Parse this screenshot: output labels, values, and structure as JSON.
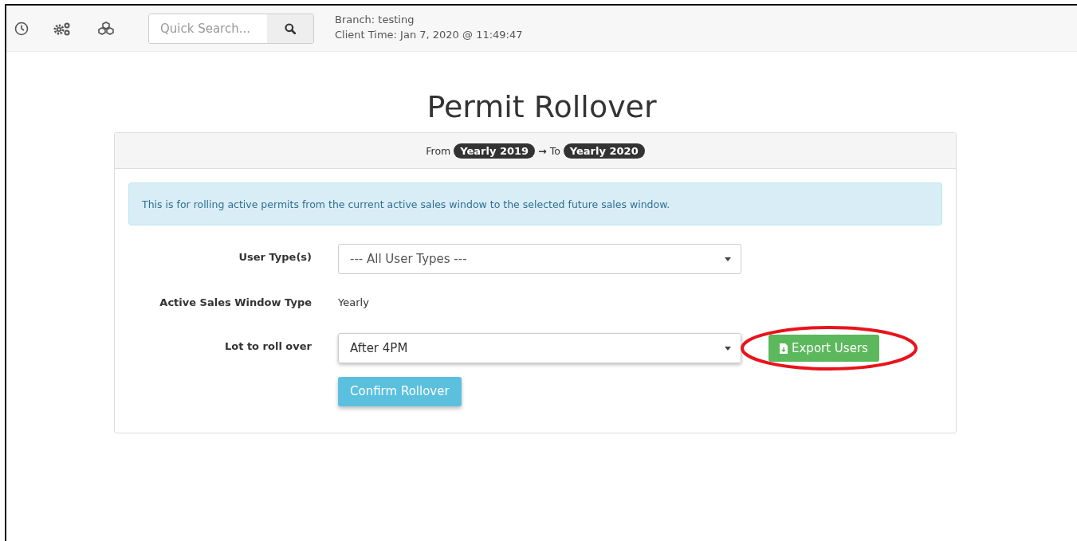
{
  "toolbar": {
    "icons": [
      {
        "kind": "clock"
      },
      {
        "kind": "gears"
      },
      {
        "kind": "cubes"
      }
    ],
    "search": {
      "placeholder": "Quick Search..."
    },
    "branch": "Branch: testing",
    "client_time": "Client Time: Jan 7, 2020 @ 11:49:47"
  },
  "page": {
    "title": "Permit Rollover"
  },
  "panel": {
    "from_label": "From",
    "from_badge": "Yearly 2019",
    "arrow": "→",
    "to_label": "To",
    "to_badge": "Yearly 2020",
    "alert": "This is for rolling active permits from the current active sales window to the selected future sales window.",
    "fields": [
      {
        "kind": "select",
        "label": "User Type(s)",
        "value": "--- All User Types ---"
      },
      {
        "kind": "text",
        "label": "Active Sales Window Type",
        "value": "Yearly"
      },
      {
        "kind": "select",
        "label": "Lot to roll over",
        "value": "After 4PM",
        "export_button": "Export Users",
        "highlighted": true
      }
    ],
    "confirm_button": "Confirm Rollover"
  }
}
